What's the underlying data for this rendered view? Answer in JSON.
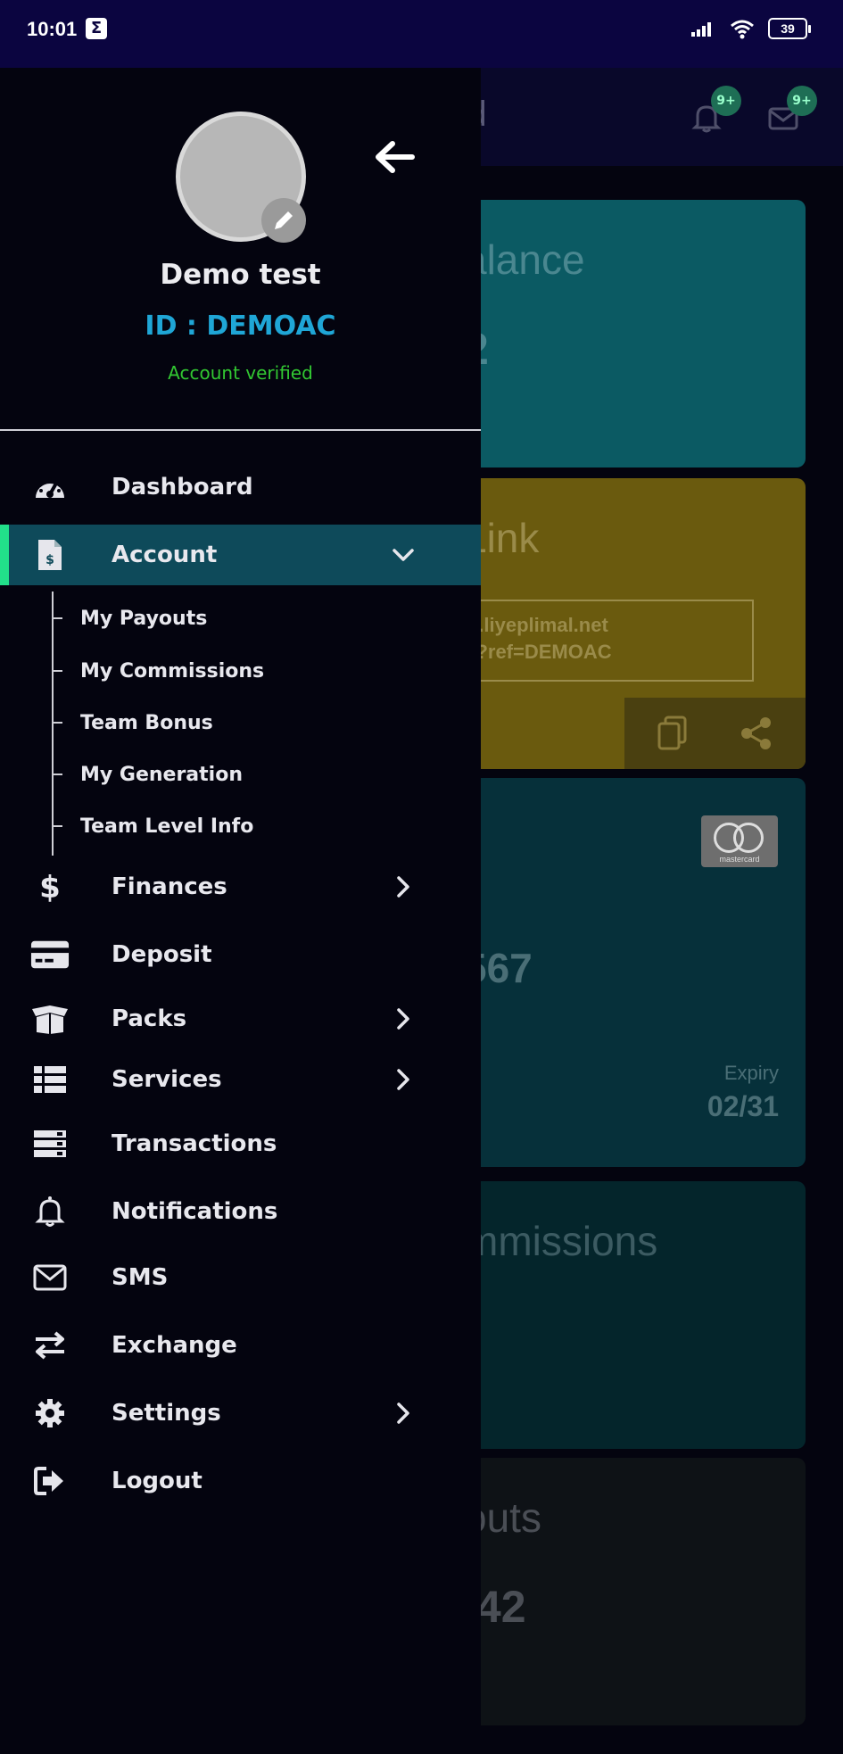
{
  "status_bar": {
    "time": "10:01",
    "notification_icon": "sigma-icon",
    "battery": "39"
  },
  "background": {
    "header_title_fragment": "rd",
    "notif_badge": "9+",
    "mail_badge": "9+",
    "cards": {
      "balance_title": "alance",
      "balance_value": "2",
      "link_title": "Link",
      "link_line1": "w.liyeplimal.net",
      "link_line2": "n?ref=DEMOAC",
      "card_number_fragment": "567",
      "card_brand": "mastercard",
      "expiry_label": "Expiry",
      "expiry_value": "02/31",
      "commissions_title": "mmissions",
      "payouts_title": "outs",
      "payouts_value": ".42"
    },
    "colors": {
      "balance": "#0b5a63",
      "link": "#6a5a0e",
      "card": "#06303a",
      "commissions": "#04252b",
      "payouts": "#0e1216"
    }
  },
  "drawer": {
    "user_name": "Demo test",
    "user_id": "ID : DEMOAC",
    "account_status": "Account verified",
    "menu": [
      {
        "label": "Dashboard",
        "icon": "speedometer-icon"
      },
      {
        "label": "Account",
        "icon": "invoice-icon",
        "active": true,
        "expanded": true
      },
      {
        "label": "Finances",
        "icon": "dollar-icon",
        "has_children": true
      },
      {
        "label": "Deposit",
        "icon": "credit-card-icon"
      },
      {
        "label": "Packs",
        "icon": "box-icon",
        "has_children": true
      },
      {
        "label": "Services",
        "icon": "list-icon",
        "has_children": true
      },
      {
        "label": "Transactions",
        "icon": "transactions-icon"
      },
      {
        "label": "Notifications",
        "icon": "bell-icon"
      },
      {
        "label": "SMS",
        "icon": "envelope-icon"
      },
      {
        "label": "Exchange",
        "icon": "exchange-icon"
      },
      {
        "label": "Settings",
        "icon": "gear-icon",
        "has_children": true
      },
      {
        "label": "Logout",
        "icon": "logout-icon"
      }
    ],
    "account_submenu": [
      "My Payouts",
      "My Commissions",
      "Team Bonus",
      "My Generation",
      "Team Level Info"
    ],
    "colors": {
      "accent": "#22e08a",
      "active_bg": "#0e4a5a",
      "id_color": "#1fa6d6",
      "verified_color": "#32c832"
    }
  }
}
